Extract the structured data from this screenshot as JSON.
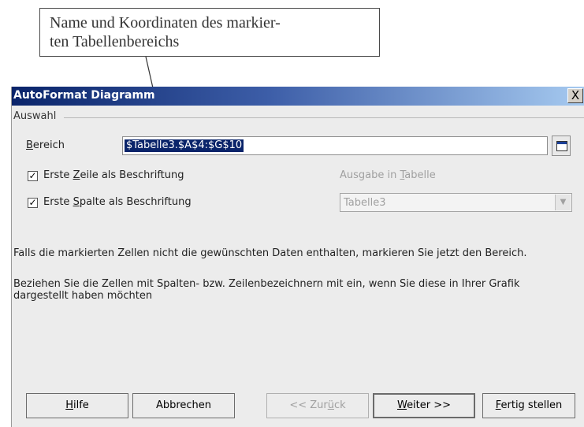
{
  "callout": {
    "line1": "Name und Koordinaten des markier-",
    "line2": "ten Tabellenbereichs"
  },
  "dialog": {
    "title": "AutoFormat Diagramm",
    "close_glyph": "X",
    "group_label": "Auswahl",
    "range_label": "Bereich",
    "range_value": "$Tabelle3.$A$4:$G$10",
    "first_row_label": "Erste Zeile als Beschriftung",
    "first_col_label": "Erste Spalte als Beschriftung",
    "first_row_checked": true,
    "first_col_checked": true,
    "output_label": "Ausgabe in Tabelle",
    "output_value": "Tabelle3",
    "info1": "Falls die markierten Zellen nicht die gewünschten Daten enthalten, markieren Sie jetzt den Bereich.",
    "info2_line1": "Beziehen Sie die Zellen mit Spalten- bzw. Zeilenbezeichnern mit ein, wenn Sie diese in Ihrer Grafik",
    "info2_line2": "dargestellt haben möchten"
  },
  "buttons": {
    "help": "Hilfe",
    "cancel": "Abbrechen",
    "back": "<< Zurück",
    "next": "Weiter >>",
    "finish": "Fertig stellen"
  },
  "icons": {
    "shrink": "shrink-range-icon",
    "dropdown": "chevron-down-icon",
    "checkmark": "checkmark-icon"
  },
  "colors": {
    "titlebar_start": "#0a246a",
    "titlebar_end": "#a6caf0",
    "selection": "#0a246a",
    "disabled_text": "#a0a0a0"
  }
}
